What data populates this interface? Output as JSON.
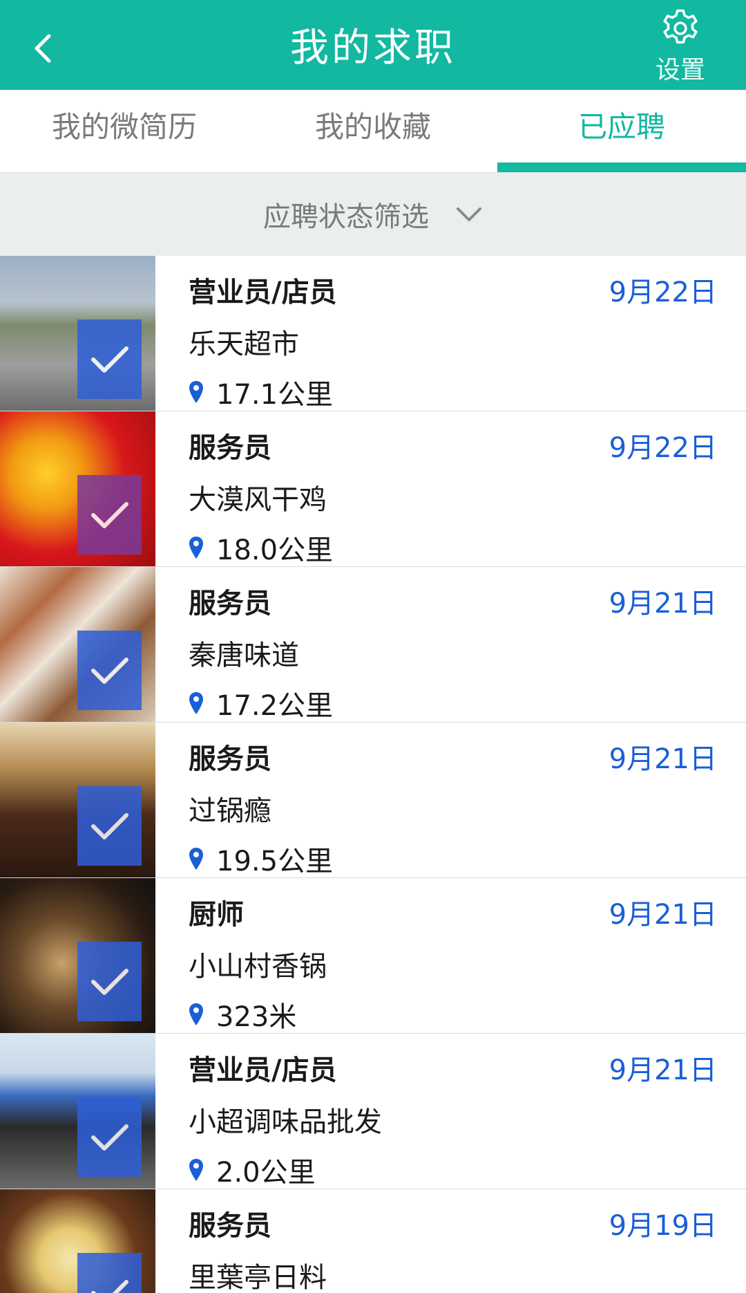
{
  "header": {
    "title": "我的求职",
    "settings_label": "设置"
  },
  "tabs": [
    {
      "label": "我的微简历",
      "active": false
    },
    {
      "label": "我的收藏",
      "active": false
    },
    {
      "label": "已应聘",
      "active": true
    }
  ],
  "filter": {
    "label": "应聘状态筛选"
  },
  "colors": {
    "primary": "#12b8a0",
    "date": "#1a5fd6",
    "check_blue": "#2f5fd8",
    "check_purple": "#7a3a9a"
  },
  "jobs": [
    {
      "title": "营业员/店员",
      "company": "乐天超市",
      "distance": "17.1公里",
      "date": "9月22日",
      "check_color": "#2f5fd8",
      "thumb_scene": "street-storefront"
    },
    {
      "title": "服务员",
      "company": "大漠风干鸡",
      "distance": "18.0公里",
      "date": "9月22日",
      "check_color": "#7a3a9a",
      "thumb_scene": "red-hiring-poster"
    },
    {
      "title": "服务员",
      "company": "秦唐味道",
      "distance": "17.2公里",
      "date": "9月21日",
      "check_color": "#2f5fd8",
      "thumb_scene": "food-menu"
    },
    {
      "title": "服务员",
      "company": "过锅瘾",
      "distance": "19.5公里",
      "date": "9月21日",
      "check_color": "#2f5fd8",
      "thumb_scene": "restaurant-interior"
    },
    {
      "title": "厨师",
      "company": "小山村香锅",
      "distance": "323米",
      "date": "9月21日",
      "check_color": "#2f5fd8",
      "thumb_scene": "cooking-dish"
    },
    {
      "title": "营业员/店员",
      "company": "小超调味品批发",
      "distance": "2.0公里",
      "date": "9月21日",
      "check_color": "#2f5fd8",
      "thumb_scene": "shop-sign"
    },
    {
      "title": "服务员",
      "company": "里葉亭日料",
      "distance": "",
      "date": "9月19日",
      "check_color": "#2f5fd8",
      "thumb_scene": "japanese-food"
    }
  ]
}
